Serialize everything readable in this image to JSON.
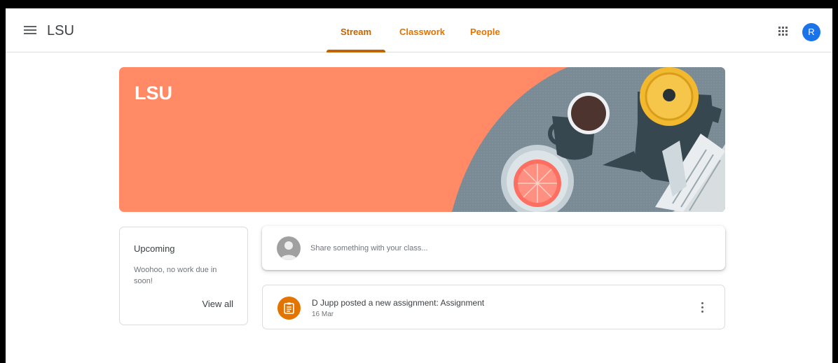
{
  "header": {
    "app_title": "LSU",
    "tabs": [
      {
        "label": "Stream",
        "active": true
      },
      {
        "label": "Classwork",
        "active": false
      },
      {
        "label": "People",
        "active": false
      }
    ],
    "avatar_initial": "R",
    "icons": {
      "menu": "hamburger-menu-icon",
      "apps": "google-apps-grid-icon"
    }
  },
  "banner": {
    "class_name": "LSU",
    "background_color": "#ff8a65"
  },
  "upcoming": {
    "title": "Upcoming",
    "message": "Woohoo, no work due in soon!",
    "view_all_label": "View all"
  },
  "share": {
    "placeholder": "Share something with your class..."
  },
  "stream": {
    "posts": [
      {
        "title": "D Jupp posted a new assignment: Assignment",
        "date": "16 Mar",
        "icon": "assignment-icon"
      }
    ]
  },
  "colors": {
    "accent": "#c26401",
    "tab_text": "#e37400",
    "avatar_bg": "#1a73e8",
    "assignment_icon_bg": "#e37400"
  }
}
